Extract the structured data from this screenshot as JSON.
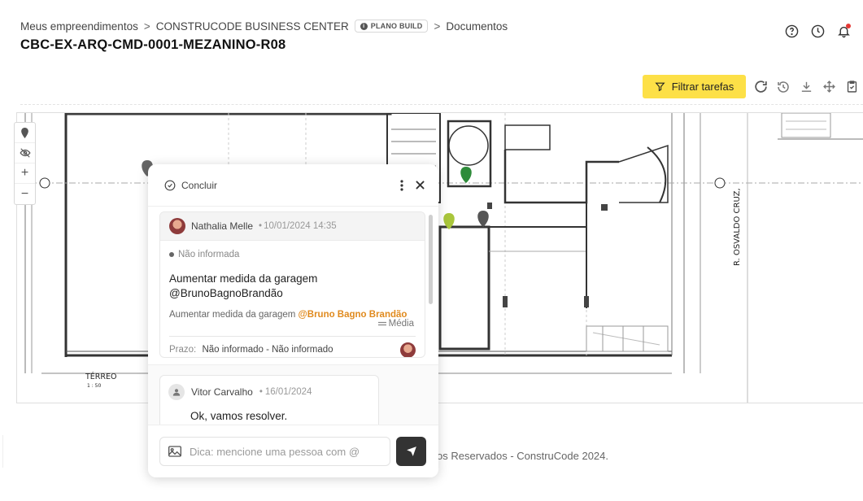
{
  "breadcrumb": {
    "items": [
      "Meus empreendimentos",
      "CONSTRUCODE BUSINESS CENTER",
      "Documentos"
    ],
    "separator": ">",
    "plan_badge": "PLANO BUILD"
  },
  "page": {
    "title": "CBC-EX-ARQ-CMD-0001-MEZANINO-R08"
  },
  "header_icons": [
    "help-icon",
    "clock-icon",
    "bell-icon"
  ],
  "toolbar": {
    "filter_label": "Filtrar tarefas",
    "tools": [
      "redo-icon",
      "history-icon",
      "download-icon",
      "move-icon",
      "clipboard-check-icon",
      "print-icon"
    ]
  },
  "plan_labels": {
    "street": "R. OSVALDO CRUZ,",
    "floor": "TÉRREO",
    "scale": "1 : 50"
  },
  "side_tools": [
    "pin-icon",
    "eye-off-icon",
    "plus-icon",
    "minus-icon"
  ],
  "panel": {
    "conclude_label": "Concluir",
    "task": {
      "author": "Nathalia Melle",
      "date": "10/01/2024 14:35",
      "status": "Não informada",
      "title_line1": "Aumentar medida da garagem",
      "title_line2": "@BrunoBagnoBrandão",
      "description": "Aumentar medida da garagem",
      "description_mention": "@Bruno Bagno Brandão",
      "priority": "Média",
      "deadline_label": "Prazo:",
      "deadline_value": "Não informado - Não informado"
    },
    "comment": {
      "author": "Vitor Carvalho",
      "date": "16/01/2024",
      "text": "Ok, vamos resolver."
    },
    "composer": {
      "placeholder": "Dica: mencione uma pessoa com @"
    }
  },
  "footer": {
    "text": "os Reservados - ConstruCode 2024."
  },
  "colors": {
    "accent_yellow": "#fde047",
    "mention_orange": "#e08a1e",
    "pin_green": "#2e8b3a",
    "pin_lime": "#a9c63b",
    "pin_gray": "#555555"
  }
}
